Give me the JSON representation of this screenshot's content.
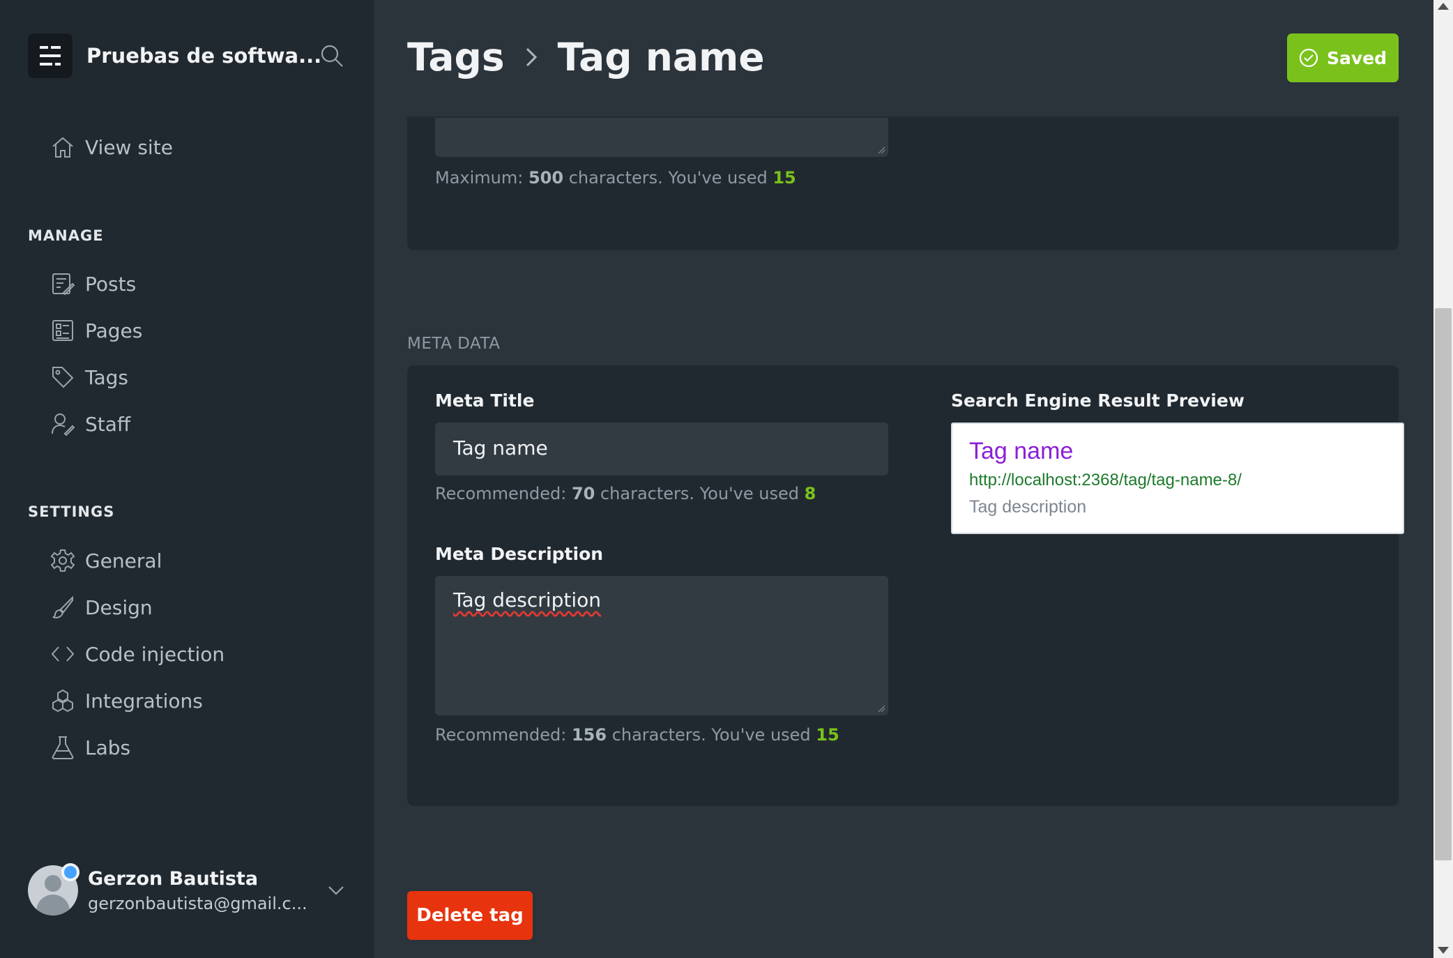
{
  "sidebar": {
    "site_title": "Pruebas de softwa...",
    "view_site": "View site",
    "manage_label": "MANAGE",
    "manage_items": [
      {
        "label": "Posts",
        "icon": "posts-icon"
      },
      {
        "label": "Pages",
        "icon": "pages-icon"
      },
      {
        "label": "Tags",
        "icon": "tag-icon"
      },
      {
        "label": "Staff",
        "icon": "staff-icon"
      }
    ],
    "settings_label": "SETTINGS",
    "settings_items": [
      {
        "label": "General",
        "icon": "gear-icon"
      },
      {
        "label": "Design",
        "icon": "brush-icon"
      },
      {
        "label": "Code injection",
        "icon": "code-icon"
      },
      {
        "label": "Integrations",
        "icon": "integrations-icon"
      },
      {
        "label": "Labs",
        "icon": "flask-icon"
      }
    ],
    "user": {
      "name": "Gerzon Bautista",
      "email": "gerzonbautista@gmail.c..."
    }
  },
  "header": {
    "breadcrumb_parent": "Tags",
    "title": "Tag name",
    "saved_label": "Saved"
  },
  "top_card": {
    "hint_prefix": "Maximum:",
    "hint_limit": "500",
    "hint_middle": "characters. You've used",
    "hint_used": "15"
  },
  "meta": {
    "heading": "META DATA",
    "title_label": "Meta Title",
    "title_value": "Tag name",
    "title_hint_prefix": "Recommended:",
    "title_hint_limit": "70",
    "title_hint_middle": "characters. You've used",
    "title_hint_used": "8",
    "description_label": "Meta Description",
    "description_value": "Tag description",
    "description_hint_prefix": "Recommended:",
    "description_hint_limit": "156",
    "description_hint_middle": "characters. You've used",
    "description_hint_used": "15",
    "preview_label": "Search Engine Result Preview",
    "preview": {
      "title": "Tag name",
      "url": "http://localhost:2368/tag/tag-name-8/",
      "description": "Tag description"
    }
  },
  "actions": {
    "delete_label": "Delete tag"
  },
  "colors": {
    "accent_green": "#7ac21b",
    "danger_red": "#e7330e",
    "sidebar_bg": "#212930",
    "main_bg": "#2b333b"
  }
}
